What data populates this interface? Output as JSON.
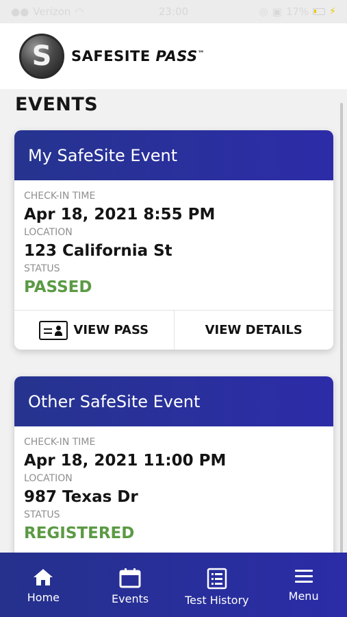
{
  "status_bar": {
    "carrier": "Verizon",
    "time": "23:00",
    "battery": "17%"
  },
  "header": {
    "logo_mark": "S",
    "brand_safesite": "SAFESITE",
    "brand_pass": "PASS",
    "trademark": "™"
  },
  "page": {
    "title": "EVENTS"
  },
  "events": [
    {
      "title": "My SafeSite Event",
      "checkin_label": "CHECK-IN TIME",
      "checkin_value": "Apr 18, 2021 8:55 PM",
      "location_label": "LOCATION",
      "location_value": "123 California St",
      "status_label": "STATUS",
      "status_value": "PASSED",
      "view_pass_label": "VIEW PASS",
      "view_details_label": "VIEW DETAILS"
    },
    {
      "title": "Other SafeSite Event",
      "checkin_label": "CHECK-IN TIME",
      "checkin_value": "Apr 18, 2021 11:00 PM",
      "location_label": "LOCATION",
      "location_value": "987 Texas Dr",
      "status_label": "STATUS",
      "status_value": "REGISTERED"
    }
  ],
  "tabs": [
    {
      "label": "Home",
      "icon": "home-icon"
    },
    {
      "label": "Events",
      "icon": "calendar-icon"
    },
    {
      "label": "Test History",
      "icon": "list-icon"
    },
    {
      "label": "Menu",
      "icon": "menu-icon"
    }
  ],
  "colors": {
    "accent": "#2b2ca7",
    "status_green": "#5b9a44"
  }
}
